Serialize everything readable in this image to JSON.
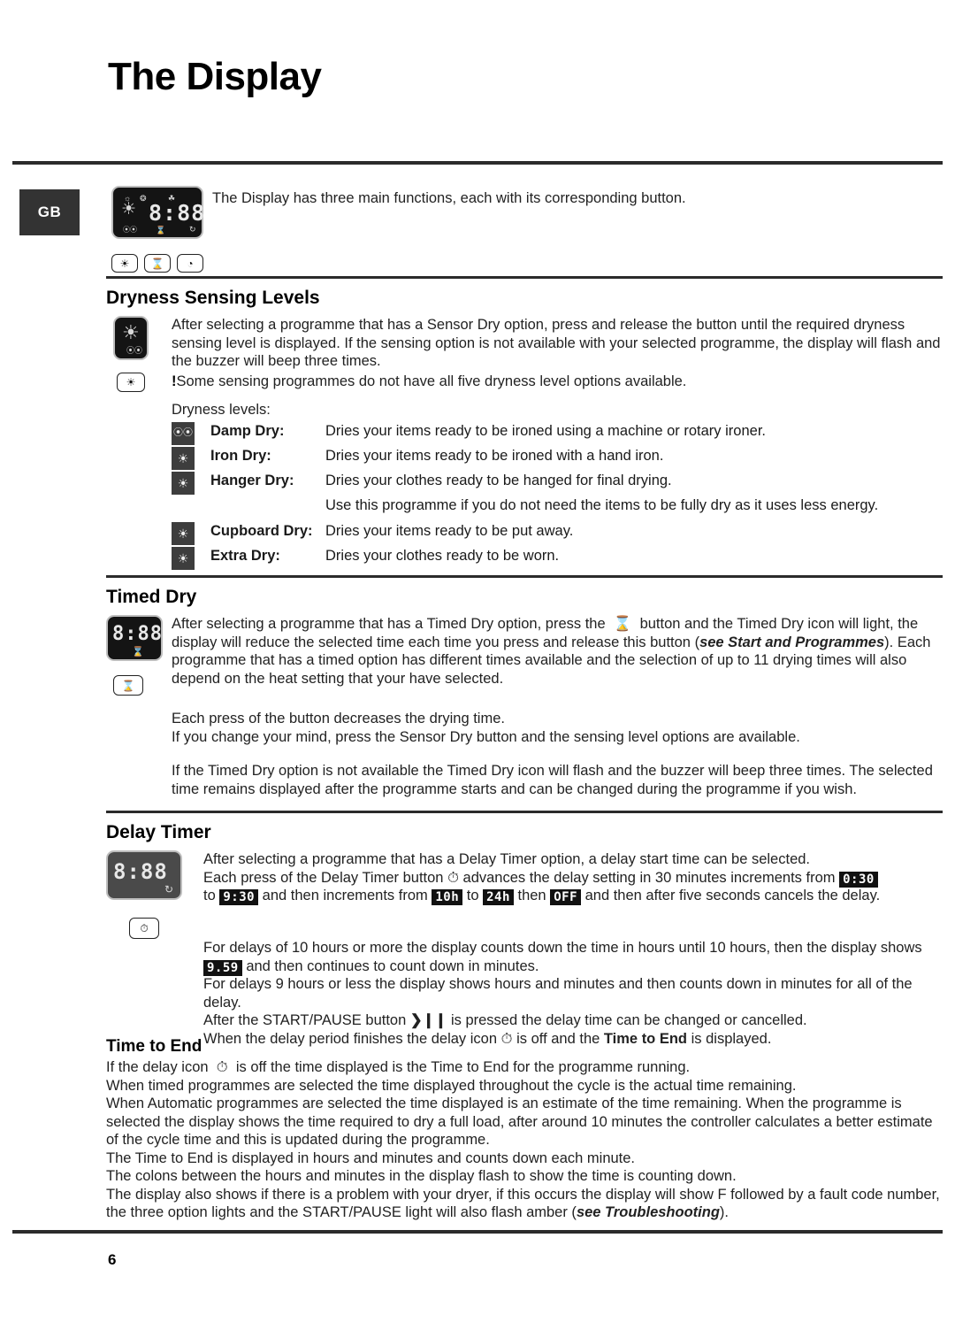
{
  "page": {
    "title": "The Display",
    "number": "6",
    "locale_badge": "GB"
  },
  "intro": {
    "text": "The Display has three main functions, each with its corresponding button.",
    "display_segment": "8:88",
    "buttons": [
      {
        "name": "sensor-dry-button",
        "glyph": "☀"
      },
      {
        "name": "timed-dry-button",
        "glyph": "⌛"
      },
      {
        "name": "delay-timer-button",
        "glyph": "◔"
      }
    ]
  },
  "dryness": {
    "heading": "Dryness Sensing Levels",
    "paragraph": "After selecting a programme that has a Sensor Dry option, press and release the button until the required dryness sensing level is displayed. If the sensing option is not available with your selected programme, the display will flash and the buzzer will beep three times.",
    "note_marker": "!",
    "note": "Some sensing programmes do not have all five dryness level options available.",
    "levels_label": "Dryness levels:",
    "levels": [
      {
        "icon": "damp-dry-icon",
        "label": "Damp Dry:",
        "description": "Dries your items ready to be ironed using a machine or rotary ironer.",
        "description2": ""
      },
      {
        "icon": "iron-dry-icon",
        "label": "Iron Dry:",
        "description": "Dries your items ready to be ironed with a hand iron.",
        "description2": ""
      },
      {
        "icon": "hanger-dry-icon",
        "label": "Hanger Dry:",
        "description": "Dries your clothes ready to be hanged for final drying.",
        "description2": "Use this programme if you do not need the items to be fully dry as it uses less energy."
      },
      {
        "icon": "cupboard-dry-icon",
        "label": "Cupboard Dry:",
        "description": "Dries your items ready to be put away.",
        "description2": ""
      },
      {
        "icon": "extra-dry-icon",
        "label": "Extra Dry:",
        "description": "Dries your clothes ready to be worn.",
        "description2": ""
      }
    ]
  },
  "timed_dry": {
    "heading": "Timed Dry",
    "display_segment": "8:88",
    "para1_a": "After selecting a programme that has a Timed Dry option, press the",
    "para1_b": "button and the Timed Dry icon will light, the display will reduce the selected time each time you press and release this button (",
    "para1_italic": "see Start and Programmes",
    "para1_c": "). Each programme that has a timed option has different times available and the selection of up to 11 drying times will also depend on the heat setting that your have selected.",
    "para2_line1": "Each press of the button decreases the drying time.",
    "para2_line2": "If you change your mind, press the Sensor Dry button and the sensing level options are available.",
    "para3": "If the Timed Dry option is not available the Timed Dry icon will flash and the buzzer will beep three times. The selected time remains displayed after the programme starts and can be changed during the programme if you wish."
  },
  "delay_timer": {
    "heading": "Delay Timer",
    "display_segment": "8:88",
    "line1": "After selecting a programme that has a Delay Timer option, a delay start time can be selected.",
    "line2_a": "Each press of the Delay Timer button",
    "line2_b": "advances the delay setting in 30 minutes increments from",
    "badge_030": "0:30",
    "line3_a": "to",
    "badge_930": "9:30",
    "line3_b": "and then increments from",
    "badge_10h": "10h",
    "line3_c": "to",
    "badge_24h": "24h",
    "line3_d": "then",
    "badge_off": "OFF",
    "line3_e": "and then after five seconds cancels the delay.",
    "line4": "For delays of 10 hours or more the display counts down the time in hours until 10 hours, then the display shows",
    "badge_959": "9.59",
    "line4_b": "and then continues to count down in minutes.",
    "line5": "For delays 9 hours or less the display shows hours and minutes and then counts down in minutes for all of the delay.",
    "line6_a": "After the START/PAUSE button",
    "line6_glyph": "❯❙❙",
    "line6_b": "is pressed the delay time can be changed or cancelled.",
    "line7_a": "When the delay period finishes the delay icon",
    "line7_b": "is off and the",
    "line7_bold": "Time to End",
    "line7_c": "is displayed."
  },
  "time_to_end": {
    "heading": "Time to End",
    "line1_a": "If the delay icon",
    "line1_b": "is off the time displayed is the Time to End for the programme running.",
    "line2": "When timed programmes are selected the time displayed throughout the cycle is the actual time remaining.",
    "line3": "When Automatic programmes are selected the time displayed is an estimate of the time remaining. When the programme is selected the display shows the time required to dry a full load, after around 10 minutes the controller calculates a better estimate of the cycle time and this is updated during the programme.",
    "line4": "The Time to End is displayed in hours and minutes and counts down each minute.",
    "line5": "The colons between the hours and minutes in the display flash to show the time is counting down.",
    "line6_a": "The display also shows if there is a problem with your dryer, if this occurs the display will show F followed by a fault code number, the three option lights and the START/PAUSE light will also flash amber (",
    "line6_italic": "see Troubleshooting",
    "line6_b": ")."
  },
  "colors": {
    "rule": "#2b2b2b",
    "badge_bg": "#333333",
    "lcd_bg": "#141414",
    "lcd_bg_grey": "#4a4a4a",
    "chip_bg": "#3d3d3d"
  }
}
